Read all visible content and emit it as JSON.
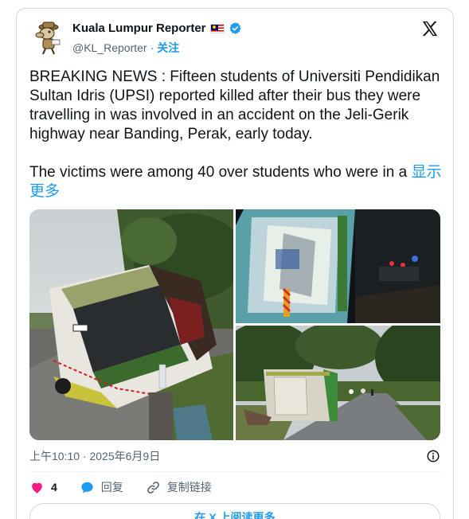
{
  "author": {
    "display_name": "Kuala Lumpur Reporter",
    "handle": "@KL_Reporter",
    "separator": "·",
    "follow_label": "关注",
    "flag_icon": "malaysia-flag-icon",
    "verified_icon": "verified-badge-icon"
  },
  "tweet": {
    "paragraph1": "BREAKING NEWS : Fifteen students of Universiti Pendidikan Sultan Idris (UPSI) reported killed after their bus they were travelling in was involved in an accident on the Jeli-Gerik highway near Banding, Perak, early today.",
    "paragraph2": "The victims were among 40 over students who were in a",
    "show_more": "显示更多"
  },
  "timestamp": "上午10:10 · 2025年6月9日",
  "actions": {
    "like_count": "4",
    "reply_label": "回复",
    "copy_link_label": "复制链接"
  },
  "read_more_label": "在 X 上阅读更多",
  "colors": {
    "accent": "#1d9bf0",
    "like": "#f91880",
    "text": "#0f1419",
    "muted": "#536471",
    "border": "#cfd9de"
  }
}
